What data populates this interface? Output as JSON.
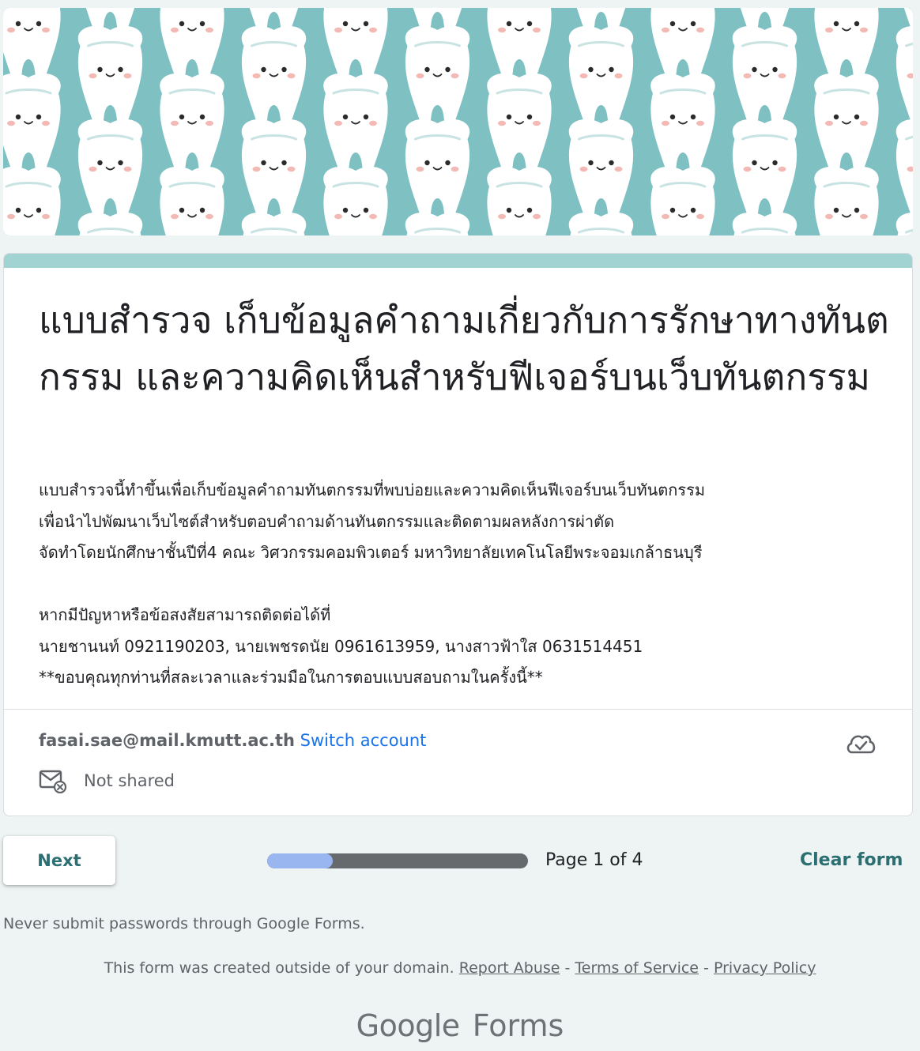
{
  "header": {
    "banner_name": "tooth-pattern-banner",
    "banner_colors": {
      "background": "#7fc1c3",
      "tooth": "#ffffff",
      "shadow": "#c9e3e3",
      "eyes": "#2b2b2b",
      "blush": "#f3b9b4"
    }
  },
  "form": {
    "accent_color": "#a2d3d3",
    "title": "แบบสำรวจ เก็บข้อมูลคำถามเกี่ยวกับการรักษาทางทันตกรรม  และความคิดเห็นสำหรับฟีเจอร์บนเว็บทันตกรรม",
    "description": {
      "line1": "แบบสำรวจนี้ทำขึ้นเพื่อเก็บข้อมูลคำถามทันตกรรมที่พบบ่อยและความคิดเห็นฟีเจอร์บนเว็บทันตกรรม",
      "line2": "เพื่อนำไปพัฒนาเว็บไซต์สำหรับตอบคำถามด้านทันตกรรมและติดตามผลหลังการผ่าตัด",
      "line3": "จัดทำโดยนักศึกษาชั้นปีที่4 คณะ วิศวกรรมคอมพิวเตอร์  มหาวิทยาลัยเทคโนโลยีพระจอมเกล้าธนบุรี",
      "line4": "หากมีปัญหาหรือข้อสงสัยสามารถติดต่อได้ที่",
      "line5": "นายชานนท์ 0921190203, นายเพชรดนัย 0961613959, นางสาวฟ้าใส 0631514451",
      "line6": "**ขอบคุณทุกท่านที่สละเวลาและร่วมมือในการตอบแบบสอบถามในครั้งนี้**"
    },
    "account": {
      "email": "fasai.sae@mail.kmutt.ac.th",
      "switch_label": "Switch account",
      "cloud_icon": "cloud-saved-icon",
      "share_icon": "mail-not-shared-icon",
      "share_status": "Not shared"
    }
  },
  "navigation": {
    "next_label": "Next",
    "progress_fraction": 0.25,
    "page_text": "Page 1 of 4",
    "clear_label": "Clear form"
  },
  "footer": {
    "warning": "Never submit passwords through Google Forms.",
    "domain_notice": "This form was created outside of your domain.",
    "report_abuse": "Report Abuse",
    "separator": " - ",
    "terms": "Terms of Service",
    "privacy": "Privacy Policy",
    "brand_google": "Google",
    "brand_product": "Forms"
  }
}
